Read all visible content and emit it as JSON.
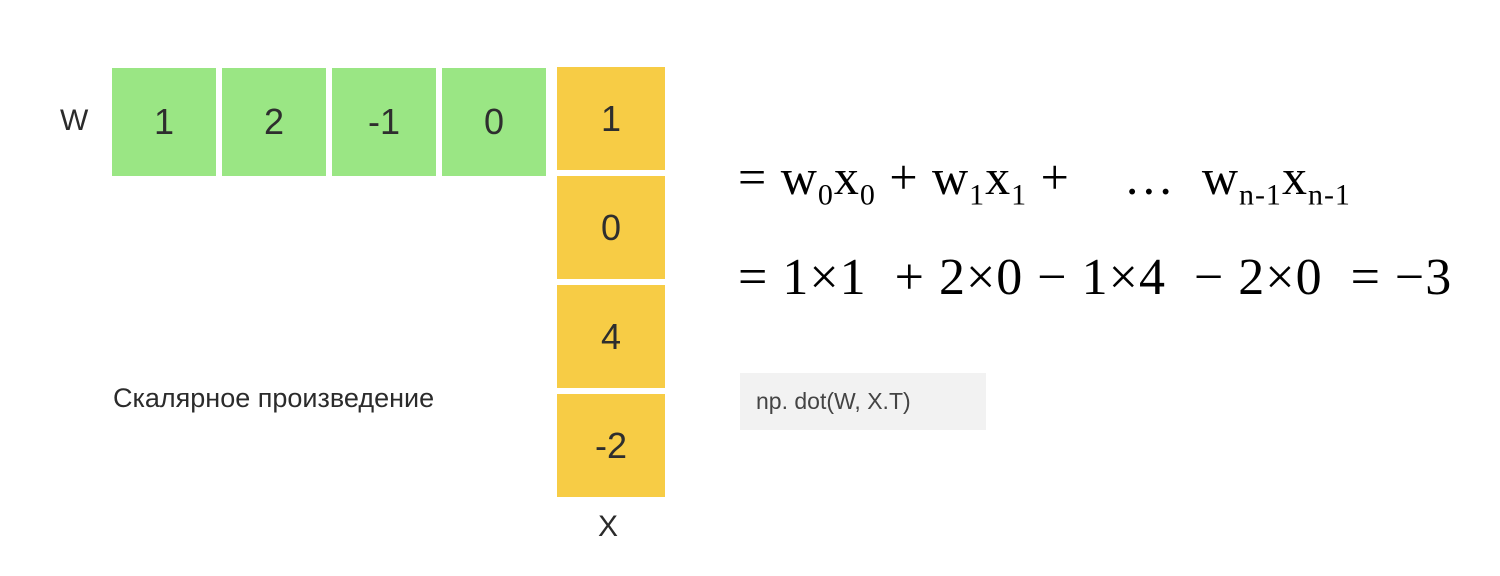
{
  "vector_w": {
    "label": "W",
    "values": [
      "1",
      "2",
      "-1",
      "0"
    ],
    "color": "#9ae684"
  },
  "vector_x": {
    "label": "X",
    "values": [
      "1",
      "0",
      "4",
      "-2"
    ],
    "color": "#f7cc45"
  },
  "caption": "Скалярное произведение",
  "formula_symbolic": {
    "eq": "= ",
    "t0_w": "w",
    "t0_wi": "0",
    "t0_x": "x",
    "t0_xi": "0",
    "plus1": " + ",
    "t1_w": "w",
    "t1_wi": "1",
    "t1_x": "x",
    "t1_xi": "1",
    "plus2": " +    ",
    "ellipsis": "…  ",
    "tn_w": "w",
    "tn_wi": "n-1",
    "tn_x": "x",
    "tn_xi": "n-1"
  },
  "formula_numeric": "= 1×1  + 2×0 − 1×4  − 2×0  = −3",
  "code": "np. dot(W, X.T)"
}
